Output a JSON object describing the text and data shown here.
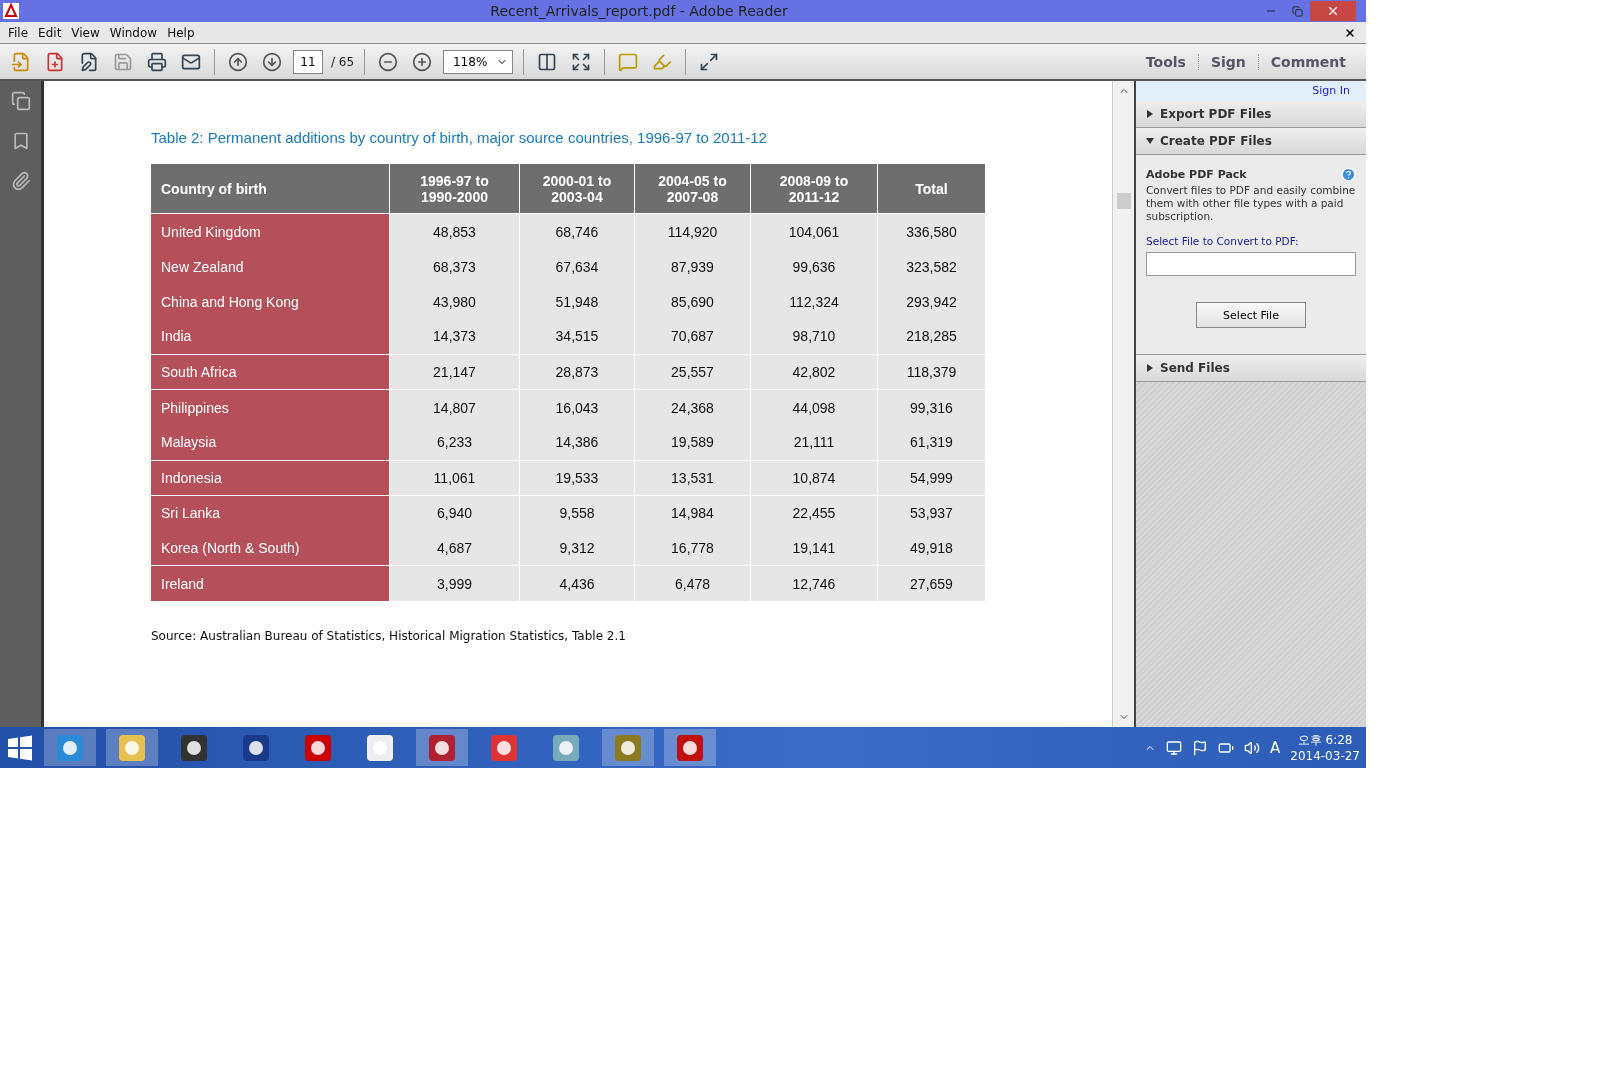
{
  "window": {
    "title": "Recent_Arrivals_report.pdf - Adobe Reader"
  },
  "menu": [
    "File",
    "Edit",
    "View",
    "Window",
    "Help"
  ],
  "toolbar": {
    "page": "11",
    "page_total": "/ 65",
    "zoom": "118%",
    "tabs": [
      "Tools",
      "Sign",
      "Comment"
    ]
  },
  "document": {
    "title": "Table 2: Permanent additions by country of birth, major source countries, 1996-97 to 2011-12",
    "table": {
      "columns": [
        "Country of birth",
        "1996-97 to 1990-2000",
        "2000-01 to 2003-04",
        "2004-05 to 2007-08",
        "2008-09 to 2011-12",
        "Total"
      ],
      "groups": [
        [
          [
            "United Kingdom",
            "48,853",
            "68,746",
            "114,920",
            "104,061",
            "336,580"
          ],
          [
            "New Zealand",
            "68,373",
            "67,634",
            "87,939",
            "99,636",
            "323,582"
          ],
          [
            "China and Hong Kong",
            "43,980",
            "51,948",
            "85,690",
            "112,324",
            "293,942"
          ],
          [
            "India",
            "14,373",
            "34,515",
            "70,687",
            "98,710",
            "218,285"
          ]
        ],
        [
          [
            "South Africa",
            "21,147",
            "28,873",
            "25,557",
            "42,802",
            "118,379"
          ]
        ],
        [
          [
            "Philippines",
            "14,807",
            "16,043",
            "24,368",
            "44,098",
            "99,316"
          ],
          [
            "Malaysia",
            "6,233",
            "14,386",
            "19,589",
            "21,111",
            "61,319"
          ]
        ],
        [
          [
            "Indonesia",
            "11,061",
            "19,533",
            "13,531",
            "10,874",
            "54,999"
          ]
        ],
        [
          [
            "Sri Lanka",
            "6,940",
            "9,558",
            "14,984",
            "22,455",
            "53,937"
          ],
          [
            "Korea (North & South)",
            "4,687",
            "9,312",
            "16,778",
            "19,141",
            "49,918"
          ]
        ],
        [
          [
            "Ireland",
            "3,999",
            "4,436",
            "6,478",
            "12,746",
            "27,659"
          ]
        ]
      ]
    },
    "source": "Source: Australian Bureau of Statistics, Historical Migration Statistics, Table 2.1"
  },
  "panel": {
    "sign_in": "Sign In",
    "sections": [
      {
        "label": "Export PDF Files",
        "expanded": false
      },
      {
        "label": "Create PDF Files",
        "expanded": true,
        "heading": "Adobe PDF Pack",
        "text": "Convert files to PDF and easily combine them with other file types with a paid subscription.",
        "field_label": "Select File to Convert to PDF:",
        "button": "Select File"
      },
      {
        "label": "Send Files",
        "expanded": false
      }
    ]
  },
  "taskbar": {
    "tray_keyboard": "A",
    "time": "오후 6:28",
    "date": "2014-03-27"
  }
}
